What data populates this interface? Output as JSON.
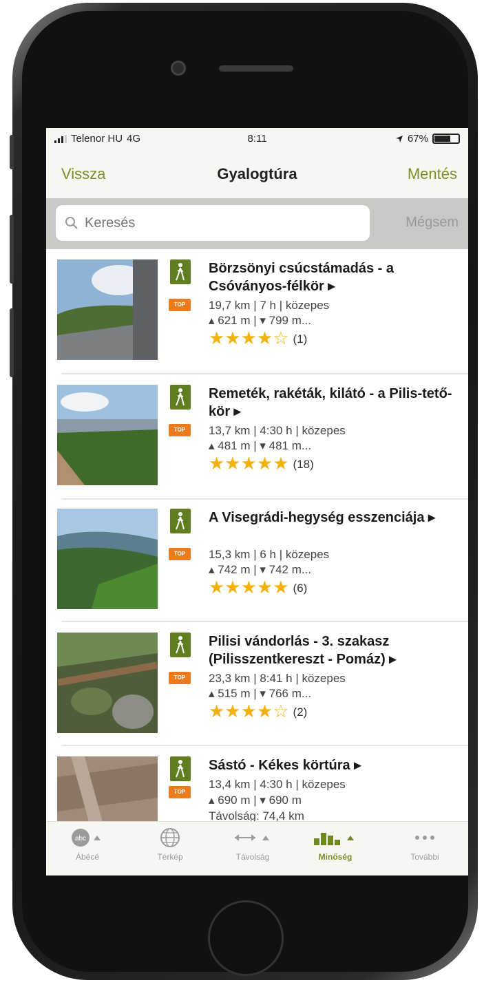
{
  "status": {
    "carrier": "Telenor HU",
    "network": "4G",
    "time": "8:11",
    "battery": "67%"
  },
  "nav": {
    "back": "Vissza",
    "title": "Gyalogtúra",
    "save": "Mentés"
  },
  "search": {
    "placeholder": "Keresés",
    "cancel": "Mégsem"
  },
  "items": [
    {
      "title": "Börzsönyi csúcstámadás - a Csóványos-félkör ▸",
      "stats": "19,7 km | 7 h | közepes",
      "elevation": "▴ 621 m | ▾ 799 m...",
      "stars": "★★★★☆",
      "reviews": "(1)",
      "badge": "TOP"
    },
    {
      "title": "Remeték, rakéták, kilátó - a Pilis-tető-kör ▸",
      "stats": "13,7 km | 4:30 h | közepes",
      "elevation": "▴ 481 m | ▾ 481 m...",
      "stars": "★★★★★",
      "reviews": "(18)",
      "badge": "TOP"
    },
    {
      "title": "A Visegrádi-hegység esszenciája ▸",
      "stats": "15,3 km | 6 h | közepes",
      "elevation": "▴ 742 m | ▾ 742 m...",
      "stars": "★★★★★",
      "reviews": "(6)",
      "badge": "TOP"
    },
    {
      "title": "Pilisi vándorlás - 3. szakasz (Pilisszentkereszt - Pomáz) ▸",
      "stats": "23,3 km | 8:41 h | közepes",
      "elevation": "▴ 515 m | ▾ 766 m...",
      "stars": "★★★★☆",
      "reviews": "(2)",
      "badge": "TOP"
    },
    {
      "title": "Sástó - Kékes körtúra ▸",
      "stats": "13,4 km | 4:30 h | közepes",
      "elevation": "▴ 690 m | ▾ 690 m",
      "distance": "Távolság: 74,4 km",
      "badge": "TOP"
    }
  ],
  "tabs": [
    {
      "label": "Ábécé",
      "icon": "abc-icon"
    },
    {
      "label": "Térkép",
      "icon": "globe-icon"
    },
    {
      "label": "Távolság",
      "icon": "distance-icon"
    },
    {
      "label": "Minőség",
      "icon": "quality-icon"
    },
    {
      "label": "További",
      "icon": "more-icon"
    }
  ],
  "colors": {
    "accent": "#7a8e2a",
    "walk_badge": "#5f7e1f",
    "top_badge": "#ea7c1d",
    "star": "#f2b20f"
  }
}
